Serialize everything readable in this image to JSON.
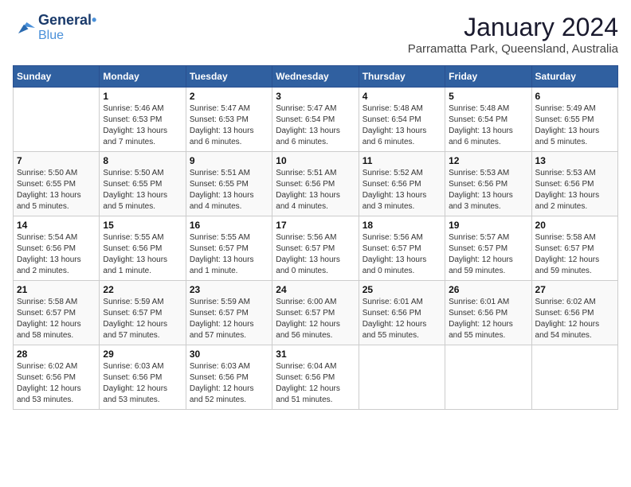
{
  "header": {
    "logo_line1": "General",
    "logo_line2": "Blue",
    "month": "January 2024",
    "location": "Parramatta Park, Queensland, Australia"
  },
  "days_of_week": [
    "Sunday",
    "Monday",
    "Tuesday",
    "Wednesday",
    "Thursday",
    "Friday",
    "Saturday"
  ],
  "weeks": [
    [
      {
        "num": "",
        "info": ""
      },
      {
        "num": "1",
        "info": "Sunrise: 5:46 AM\nSunset: 6:53 PM\nDaylight: 13 hours\nand 7 minutes."
      },
      {
        "num": "2",
        "info": "Sunrise: 5:47 AM\nSunset: 6:53 PM\nDaylight: 13 hours\nand 6 minutes."
      },
      {
        "num": "3",
        "info": "Sunrise: 5:47 AM\nSunset: 6:54 PM\nDaylight: 13 hours\nand 6 minutes."
      },
      {
        "num": "4",
        "info": "Sunrise: 5:48 AM\nSunset: 6:54 PM\nDaylight: 13 hours\nand 6 minutes."
      },
      {
        "num": "5",
        "info": "Sunrise: 5:48 AM\nSunset: 6:54 PM\nDaylight: 13 hours\nand 6 minutes."
      },
      {
        "num": "6",
        "info": "Sunrise: 5:49 AM\nSunset: 6:55 PM\nDaylight: 13 hours\nand 5 minutes."
      }
    ],
    [
      {
        "num": "7",
        "info": "Sunrise: 5:50 AM\nSunset: 6:55 PM\nDaylight: 13 hours\nand 5 minutes."
      },
      {
        "num": "8",
        "info": "Sunrise: 5:50 AM\nSunset: 6:55 PM\nDaylight: 13 hours\nand 5 minutes."
      },
      {
        "num": "9",
        "info": "Sunrise: 5:51 AM\nSunset: 6:55 PM\nDaylight: 13 hours\nand 4 minutes."
      },
      {
        "num": "10",
        "info": "Sunrise: 5:51 AM\nSunset: 6:56 PM\nDaylight: 13 hours\nand 4 minutes."
      },
      {
        "num": "11",
        "info": "Sunrise: 5:52 AM\nSunset: 6:56 PM\nDaylight: 13 hours\nand 3 minutes."
      },
      {
        "num": "12",
        "info": "Sunrise: 5:53 AM\nSunset: 6:56 PM\nDaylight: 13 hours\nand 3 minutes."
      },
      {
        "num": "13",
        "info": "Sunrise: 5:53 AM\nSunset: 6:56 PM\nDaylight: 13 hours\nand 2 minutes."
      }
    ],
    [
      {
        "num": "14",
        "info": "Sunrise: 5:54 AM\nSunset: 6:56 PM\nDaylight: 13 hours\nand 2 minutes."
      },
      {
        "num": "15",
        "info": "Sunrise: 5:55 AM\nSunset: 6:56 PM\nDaylight: 13 hours\nand 1 minute."
      },
      {
        "num": "16",
        "info": "Sunrise: 5:55 AM\nSunset: 6:57 PM\nDaylight: 13 hours\nand 1 minute."
      },
      {
        "num": "17",
        "info": "Sunrise: 5:56 AM\nSunset: 6:57 PM\nDaylight: 13 hours\nand 0 minutes."
      },
      {
        "num": "18",
        "info": "Sunrise: 5:56 AM\nSunset: 6:57 PM\nDaylight: 13 hours\nand 0 minutes."
      },
      {
        "num": "19",
        "info": "Sunrise: 5:57 AM\nSunset: 6:57 PM\nDaylight: 12 hours\nand 59 minutes."
      },
      {
        "num": "20",
        "info": "Sunrise: 5:58 AM\nSunset: 6:57 PM\nDaylight: 12 hours\nand 59 minutes."
      }
    ],
    [
      {
        "num": "21",
        "info": "Sunrise: 5:58 AM\nSunset: 6:57 PM\nDaylight: 12 hours\nand 58 minutes."
      },
      {
        "num": "22",
        "info": "Sunrise: 5:59 AM\nSunset: 6:57 PM\nDaylight: 12 hours\nand 57 minutes."
      },
      {
        "num": "23",
        "info": "Sunrise: 5:59 AM\nSunset: 6:57 PM\nDaylight: 12 hours\nand 57 minutes."
      },
      {
        "num": "24",
        "info": "Sunrise: 6:00 AM\nSunset: 6:57 PM\nDaylight: 12 hours\nand 56 minutes."
      },
      {
        "num": "25",
        "info": "Sunrise: 6:01 AM\nSunset: 6:56 PM\nDaylight: 12 hours\nand 55 minutes."
      },
      {
        "num": "26",
        "info": "Sunrise: 6:01 AM\nSunset: 6:56 PM\nDaylight: 12 hours\nand 55 minutes."
      },
      {
        "num": "27",
        "info": "Sunrise: 6:02 AM\nSunset: 6:56 PM\nDaylight: 12 hours\nand 54 minutes."
      }
    ],
    [
      {
        "num": "28",
        "info": "Sunrise: 6:02 AM\nSunset: 6:56 PM\nDaylight: 12 hours\nand 53 minutes."
      },
      {
        "num": "29",
        "info": "Sunrise: 6:03 AM\nSunset: 6:56 PM\nDaylight: 12 hours\nand 53 minutes."
      },
      {
        "num": "30",
        "info": "Sunrise: 6:03 AM\nSunset: 6:56 PM\nDaylight: 12 hours\nand 52 minutes."
      },
      {
        "num": "31",
        "info": "Sunrise: 6:04 AM\nSunset: 6:56 PM\nDaylight: 12 hours\nand 51 minutes."
      },
      {
        "num": "",
        "info": ""
      },
      {
        "num": "",
        "info": ""
      },
      {
        "num": "",
        "info": ""
      }
    ]
  ]
}
